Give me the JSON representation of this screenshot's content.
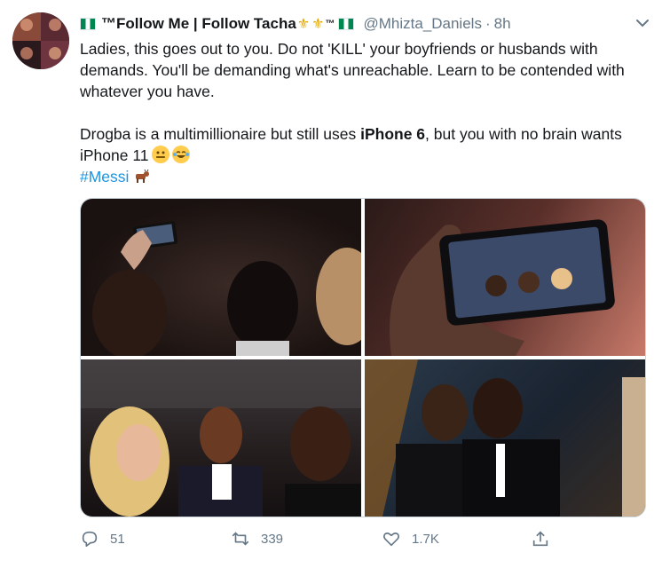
{
  "tweet": {
    "display_name": "™Follow Me | Follow Tacha",
    "display_name_suffix": "™",
    "handle": "@Mhizta_Daniels",
    "separator": "·",
    "time": "8h",
    "paragraph1": "Ladies, this goes out to you. Do not 'KILL' your boyfriends or husbands with demands. You'll be demanding what's unreachable. Learn to be  contended with whatever you have.",
    "p2_before": "Drogba is a multimillionaire but still uses ",
    "p2_bold": "iPhone 6",
    "p2_after": ", but you with no brain wants iPhone 11",
    "hashtag": "#Messi"
  },
  "actions": {
    "reply_count": "51",
    "retweet_count": "339",
    "like_count": "1.7K"
  },
  "icons": {
    "flag": "nigeria-flag-icon",
    "crown": "trident-icon",
    "reply": "reply-icon",
    "retweet": "retweet-icon",
    "like": "heart-icon",
    "share": "share-icon",
    "more": "chevron-down-icon"
  },
  "colors": {
    "text": "#14171a",
    "secondary": "#657786",
    "link": "#1b95e0",
    "flag_green": "#008751"
  }
}
